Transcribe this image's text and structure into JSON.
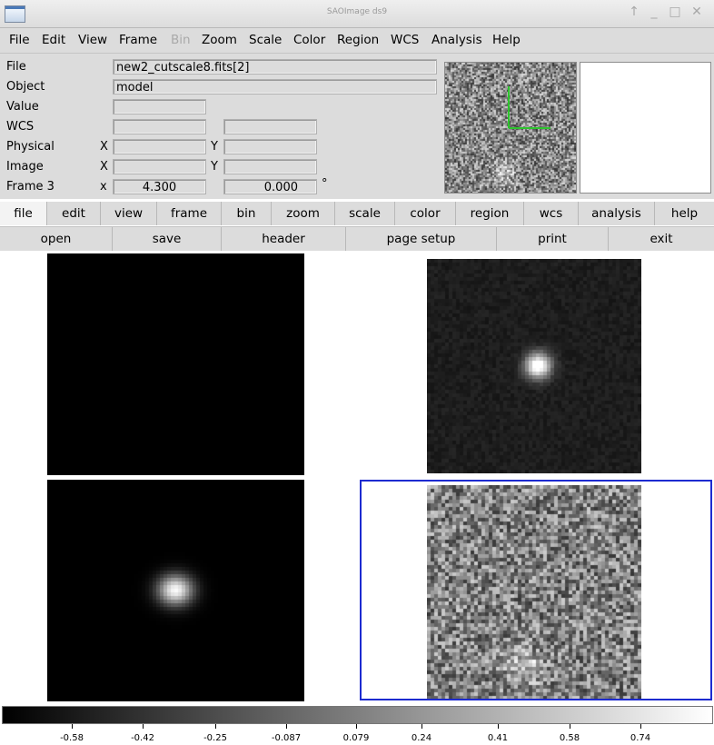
{
  "window": {
    "title": "SAOImage ds9",
    "controls": [
      "↑",
      "_",
      "□",
      "✕"
    ]
  },
  "menubar": [
    "File",
    "Edit",
    "View",
    "Frame",
    "Bin",
    "Zoom",
    "Scale",
    "Color",
    "Region",
    "WCS",
    "Analysis",
    "Help"
  ],
  "menubar_disabled": [
    "Bin"
  ],
  "info": {
    "file_label": "File",
    "file_value": "new2_cutscale8.fits[2]",
    "object_label": "Object",
    "object_value": "model",
    "value_label": "Value",
    "value_value": "",
    "wcs_label": "WCS",
    "wcs_a": "",
    "wcs_b": "",
    "physical_label": "Physical",
    "physical_x_axis": "X",
    "physical_x": "",
    "physical_y_axis": "Y",
    "physical_y": "",
    "image_label": "Image",
    "image_x_axis": "X",
    "image_x": "",
    "image_y_axis": "Y",
    "image_y": "",
    "frame_label": "Frame 3",
    "frame_x_axis": "x",
    "frame_zoom": "4.300",
    "frame_angle": "0.000",
    "frame_angle_unit": "°"
  },
  "buttonbar_top": [
    "file",
    "edit",
    "view",
    "frame",
    "bin",
    "zoom",
    "scale",
    "color",
    "region",
    "wcs",
    "analysis",
    "help"
  ],
  "buttonbar_bottom": [
    "open",
    "save",
    "header",
    "page setup",
    "print",
    "exit"
  ],
  "colors": {
    "current_frame_border": "#1d2bd0",
    "panner_compass": "#2ec42e"
  },
  "colorbar": {
    "ticks": [
      "-0.58",
      "-0.42",
      "-0.25",
      "-0.087",
      "0.079",
      "0.24",
      "0.41",
      "0.58",
      "0.74"
    ]
  }
}
